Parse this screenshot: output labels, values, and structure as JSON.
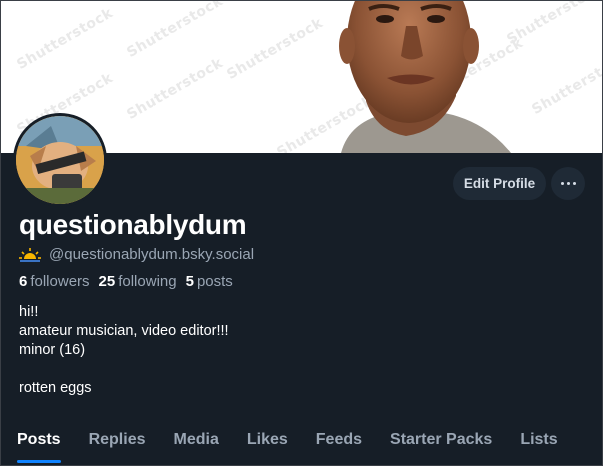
{
  "banner": {
    "watermark_text": "Shutterstock"
  },
  "profile": {
    "display_name": "questionablydum",
    "handle": "@questionablydum.bsky.social",
    "handle_icon": "sunrise-icon",
    "edit_button_label": "Edit Profile",
    "more_button_icon": "ellipsis-icon"
  },
  "stats": {
    "followers_count": "6",
    "followers_label": "followers",
    "following_count": "25",
    "following_label": "following",
    "posts_count": "5",
    "posts_label": "posts"
  },
  "bio": {
    "lines": [
      "hi!!",
      "amateur musician, video editor!!!",
      "minor (16)",
      "",
      "rotten eggs"
    ]
  },
  "tabs": [
    {
      "label": "Posts",
      "active": true
    },
    {
      "label": "Replies",
      "active": false
    },
    {
      "label": "Media",
      "active": false
    },
    {
      "label": "Likes",
      "active": false
    },
    {
      "label": "Feeds",
      "active": false
    },
    {
      "label": "Starter Packs",
      "active": false
    },
    {
      "label": "Lists",
      "active": false
    }
  ],
  "colors": {
    "background": "#161e27",
    "accent": "#1083fe",
    "muted_text": "#9aa6b4",
    "button_bg": "#1f2a36"
  }
}
